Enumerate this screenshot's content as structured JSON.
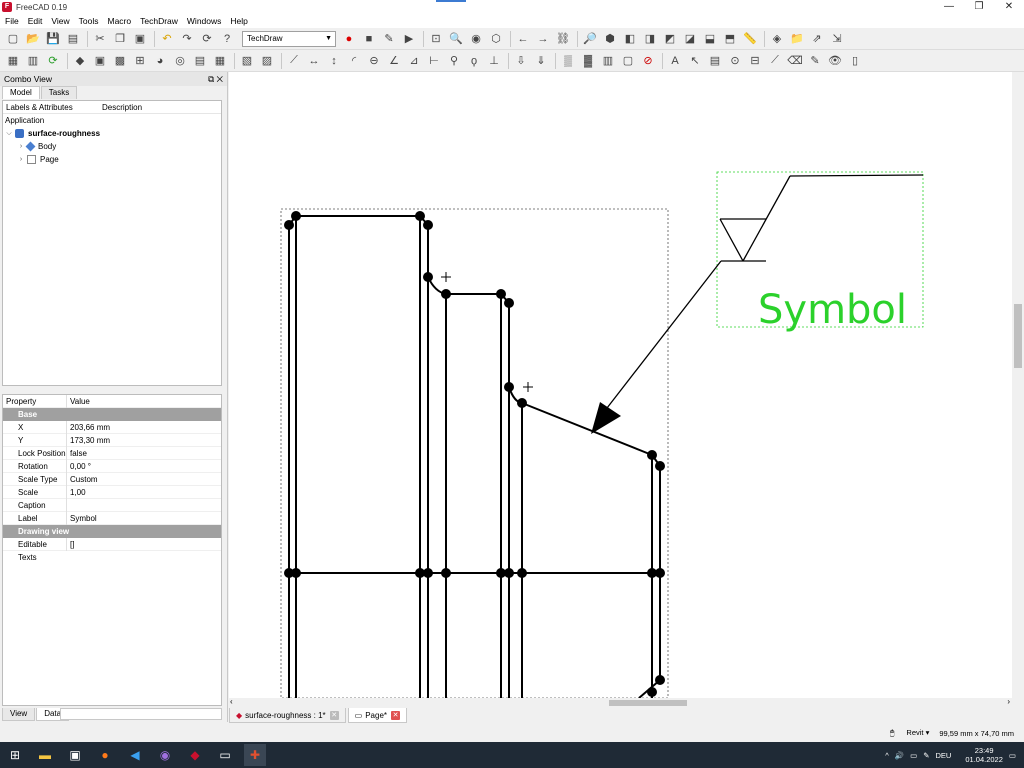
{
  "window": {
    "title": "FreeCAD 0.19",
    "min": "—",
    "max": "❐",
    "close": "✕"
  },
  "menu": [
    "File",
    "Edit",
    "View",
    "Tools",
    "Macro",
    "TechDraw",
    "Windows",
    "Help"
  ],
  "toolbar": {
    "workbench": "TechDraw"
  },
  "combo_view": {
    "title": "Combo View",
    "tabs": [
      "Model",
      "Tasks"
    ],
    "bottom_tabs": [
      "View",
      "Data"
    ]
  },
  "tree": {
    "columns": [
      "Labels & Attributes",
      "Description"
    ],
    "application": "Application",
    "items": [
      {
        "label": "surface-roughness",
        "level": 0
      },
      {
        "label": "Body",
        "level": 1
      },
      {
        "label": "Page",
        "level": 1
      }
    ]
  },
  "properties": {
    "columns": [
      "Property",
      "Value"
    ],
    "group_base": "Base",
    "group_drawing": "Drawing view",
    "rows": [
      {
        "key": "X",
        "value": "203,66 mm"
      },
      {
        "key": "Y",
        "value": "173,30 mm"
      },
      {
        "key": "Lock Position",
        "value": "false"
      },
      {
        "key": "Rotation",
        "value": "0,00 °"
      },
      {
        "key": "Scale Type",
        "value": "Custom"
      },
      {
        "key": "Scale",
        "value": "1,00"
      },
      {
        "key": "Caption",
        "value": ""
      },
      {
        "key": "Label",
        "value": "Symbol"
      }
    ],
    "drawing_rows": [
      {
        "key": "Editable Texts",
        "value": "[]"
      }
    ]
  },
  "drawing": {
    "symbol_text": "Symbol",
    "symbol_color": "#2bd12b"
  },
  "doc_tabs": [
    "surface-roughness : 1*",
    "Page*"
  ],
  "status": {
    "nav": "Revit",
    "dims": "99,59 mm x 74,70 mm"
  },
  "taskbar": {
    "lang": "DEU",
    "time": "23:49",
    "date": "01.04.2022"
  }
}
